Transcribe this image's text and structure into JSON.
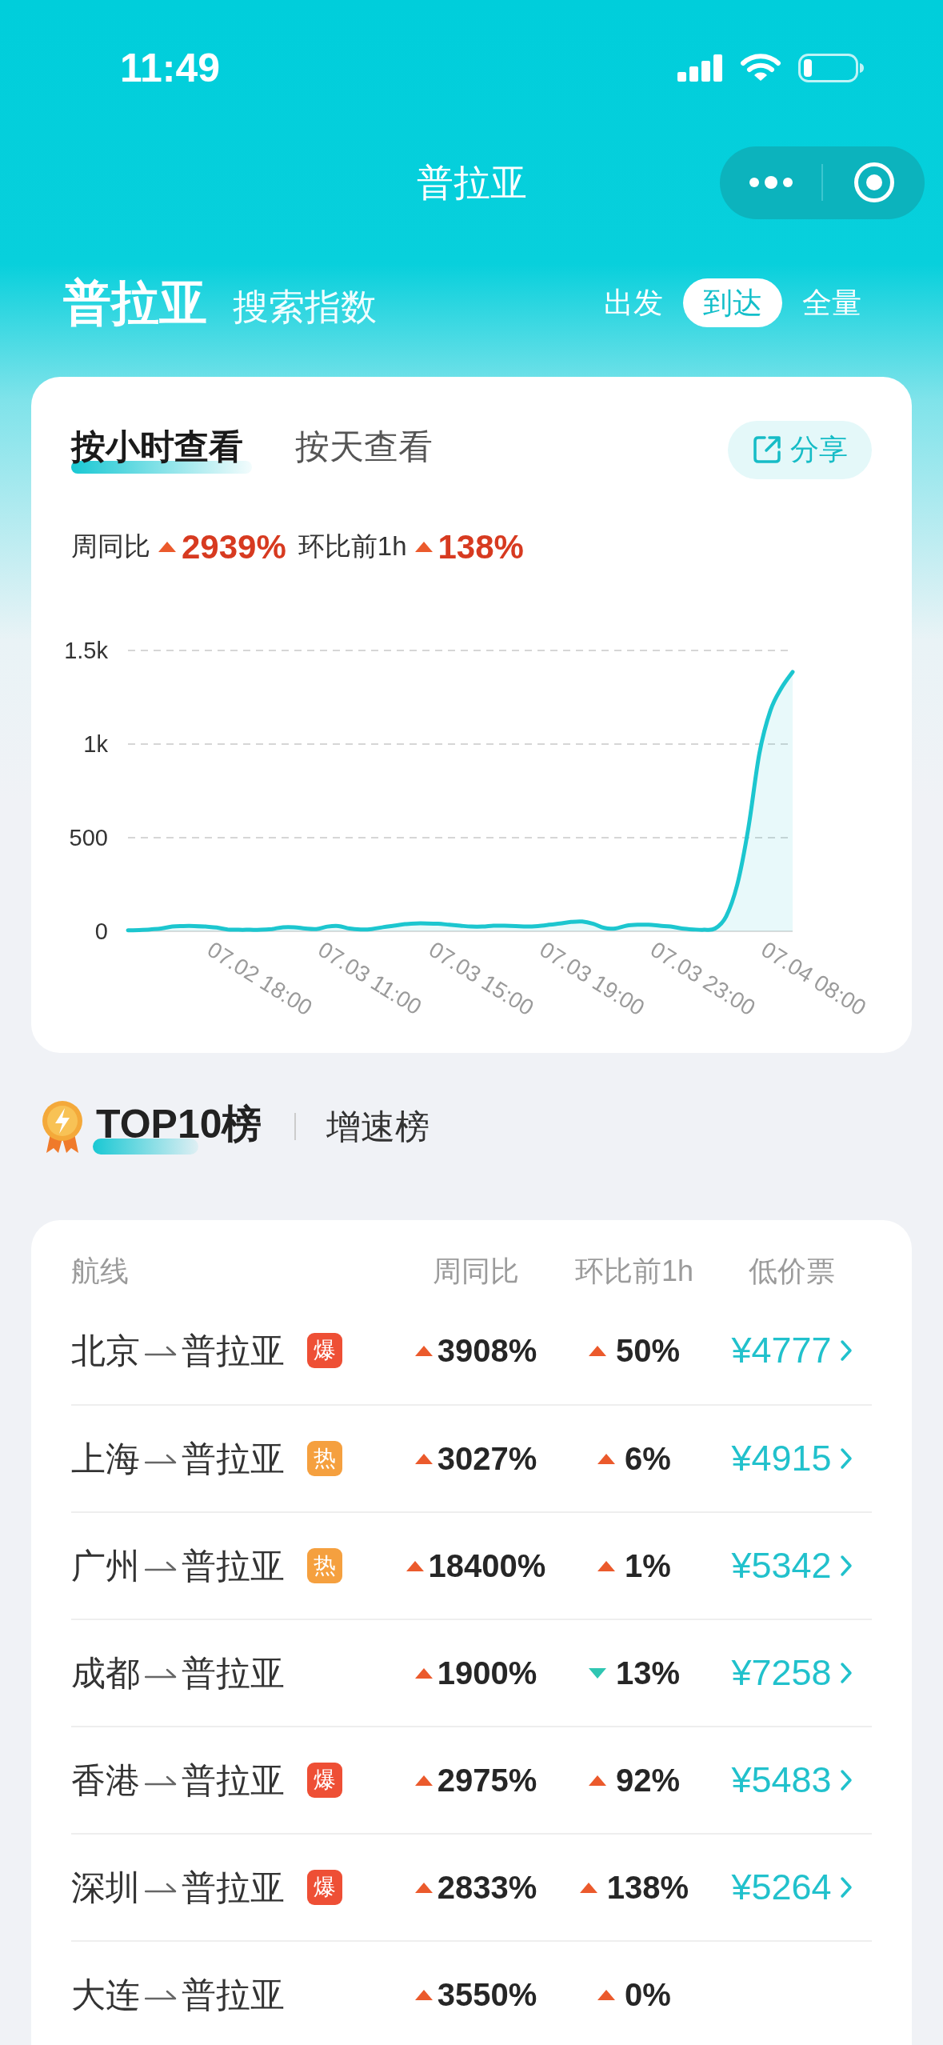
{
  "status_bar": {
    "time": "11:49"
  },
  "nav_bar": {
    "title": "普拉亚"
  },
  "header": {
    "title": "普拉亚",
    "subtitle": "搜索指数",
    "direction_tabs": [
      {
        "label": "出发",
        "selected": false
      },
      {
        "label": "到达",
        "selected": true
      },
      {
        "label": "全量",
        "selected": false
      }
    ]
  },
  "trend_card": {
    "tabs": [
      {
        "label": "按小时查看",
        "selected": true
      },
      {
        "label": "按天查看",
        "selected": false
      }
    ],
    "share_button": "分享",
    "stats": [
      {
        "label": "周同比",
        "value": "2939%",
        "up": true
      },
      {
        "label": "环比前1h",
        "value": "138%",
        "up": true
      }
    ],
    "chart_data": {
      "type": "area",
      "categories": [
        null,
        null,
        null,
        null,
        null,
        null,
        null,
        "07.02 18:00",
        null,
        null,
        null,
        null,
        null,
        null,
        null,
        null,
        null,
        "07.03 11:00",
        null,
        null,
        null,
        null,
        null,
        null,
        null,
        null,
        null,
        "07.03 15:00",
        null,
        null,
        null,
        null,
        null,
        null,
        null,
        null,
        null,
        "07.03 19:00",
        null,
        null,
        null,
        null,
        null,
        null,
        null,
        null,
        null,
        "07.03 23:00",
        null,
        null,
        null,
        null,
        null,
        null,
        null,
        null,
        null,
        "07.04 08:00",
        null,
        null,
        null
      ],
      "series": [
        {
          "color": "#1cc6cf",
          "values": [
            5,
            7,
            10,
            15,
            25,
            28,
            28,
            25,
            20,
            10,
            8,
            8,
            8,
            12,
            22,
            22,
            15,
            12,
            25,
            28,
            15,
            10,
            12,
            22,
            30,
            38,
            42,
            42,
            40,
            35,
            30,
            25,
            25,
            30,
            30,
            28,
            25,
            28,
            35,
            42,
            50,
            52,
            40,
            18,
            15,
            30,
            35,
            35,
            30,
            25,
            15,
            10,
            8,
            15,
            80,
            250,
            550,
            950,
            1180,
            1300,
            1385
          ]
        }
      ],
      "ylim": [
        0,
        1500
      ],
      "yticks": [
        0,
        500,
        {
          "value": 1000,
          "label": "1k"
        },
        {
          "value": 1500,
          "label": "1.5k"
        }
      ]
    }
  },
  "ranking": {
    "tabs": [
      {
        "label": "TOP10榜",
        "selected": true
      },
      {
        "label": "增速榜",
        "selected": false
      }
    ],
    "table": {
      "columns": [
        "航线",
        "周同比",
        "环比前1h",
        "低价票"
      ],
      "rows": [
        {
          "route": {
            "from": "北京",
            "to": "普拉亚"
          },
          "badge": {
            "text": "爆",
            "color": "#ee4f35"
          },
          "week_change": {
            "value": "3908%",
            "up": true
          },
          "hour_change": {
            "value": "50%",
            "up": true
          },
          "price": "¥4777"
        },
        {
          "route": {
            "from": "上海",
            "to": "普拉亚"
          },
          "badge": {
            "text": "热",
            "color": "#f5a03f"
          },
          "week_change": {
            "value": "3027%",
            "up": true
          },
          "hour_change": {
            "value": "6%",
            "up": true
          },
          "price": "¥4915"
        },
        {
          "route": {
            "from": "广州",
            "to": "普拉亚"
          },
          "badge": {
            "text": "热",
            "color": "#f5a03f"
          },
          "week_change": {
            "value": "18400%",
            "up": true
          },
          "hour_change": {
            "value": "1%",
            "up": true
          },
          "price": "¥5342"
        },
        {
          "route": {
            "from": "成都",
            "to": "普拉亚"
          },
          "week_change": {
            "value": "1900%",
            "up": true
          },
          "hour_change": {
            "value": "13%",
            "up": false
          },
          "price": "¥7258"
        },
        {
          "route": {
            "from": "香港",
            "to": "普拉亚"
          },
          "badge": {
            "text": "爆",
            "color": "#ee4f35"
          },
          "week_change": {
            "value": "2975%",
            "up": true
          },
          "hour_change": {
            "value": "92%",
            "up": true
          },
          "price": "¥5483"
        },
        {
          "route": {
            "from": "深圳",
            "to": "普拉亚"
          },
          "badge": {
            "text": "爆",
            "color": "#ee4f35"
          },
          "week_change": {
            "value": "2833%",
            "up": true
          },
          "hour_change": {
            "value": "138%",
            "up": true
          },
          "price": "¥5264"
        },
        {
          "route": {
            "from": "大连",
            "to": "普拉亚"
          },
          "week_change": {
            "value": "3550%",
            "up": true
          },
          "hour_change": {
            "value": "0%",
            "up": true
          }
        }
      ]
    }
  }
}
